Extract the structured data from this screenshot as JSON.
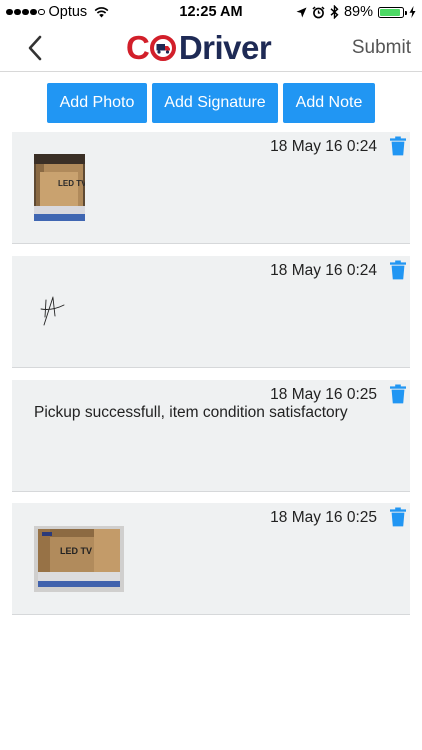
{
  "status_bar": {
    "carrier": "Optus",
    "time": "12:25 AM",
    "battery_percent": "89%",
    "battery_level": 0.89,
    "icons": [
      "signal-dots-icon",
      "wifi-icon",
      "location-arrow-icon",
      "alarm-icon",
      "bluetooth-icon",
      "battery-icon",
      "charging-bolt-icon"
    ]
  },
  "nav": {
    "back_icon": "chevron-left-icon",
    "logo_co": "C",
    "logo_driver": "Driver",
    "submit_label": "Submit"
  },
  "actions": {
    "add_photo": "Add Photo",
    "add_signature": "Add Signature",
    "add_note": "Add Note"
  },
  "colors": {
    "accent": "#2196f3",
    "logo_red": "#d21f2a",
    "logo_navy": "#1e2a55",
    "card_bg": "#eff1f2"
  },
  "items": [
    {
      "type": "photo",
      "timestamp": "18 May 16 0:24"
    },
    {
      "type": "signature",
      "timestamp": "18 May 16 0:24"
    },
    {
      "type": "note",
      "timestamp": "18 May 16 0:25",
      "text": "Pickup successfull, item condition satisfactory"
    },
    {
      "type": "photo",
      "timestamp": "18 May 16 0:25"
    }
  ]
}
